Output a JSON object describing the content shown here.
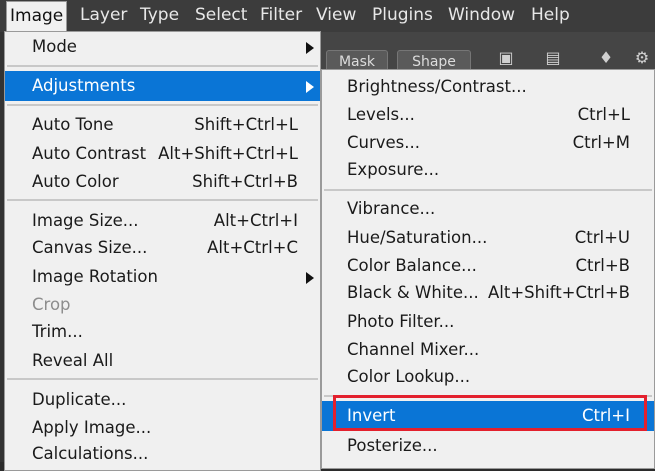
{
  "menubar": {
    "items": [
      "Image",
      "Layer",
      "Type",
      "Select",
      "Filter",
      "View",
      "Plugins",
      "Window",
      "Help"
    ]
  },
  "toolbar_behind": {
    "mask_label": "Mask",
    "shape_label": "Shape"
  },
  "image_menu": {
    "items": [
      {
        "label": "Mode",
        "shortcut": "",
        "submenu": true
      },
      {
        "label": "Adjustments",
        "shortcut": "",
        "submenu": true,
        "highlighted": true
      },
      {
        "label": "Auto Tone",
        "shortcut": "Shift+Ctrl+L"
      },
      {
        "label": "Auto Contrast",
        "shortcut": "Alt+Shift+Ctrl+L"
      },
      {
        "label": "Auto Color",
        "shortcut": "Shift+Ctrl+B"
      },
      {
        "label": "Image Size...",
        "shortcut": "Alt+Ctrl+I"
      },
      {
        "label": "Canvas Size...",
        "shortcut": "Alt+Ctrl+C"
      },
      {
        "label": "Image Rotation",
        "shortcut": "",
        "submenu": true
      },
      {
        "label": "Crop",
        "shortcut": "",
        "disabled": true
      },
      {
        "label": "Trim...",
        "shortcut": ""
      },
      {
        "label": "Reveal All",
        "shortcut": ""
      },
      {
        "label": "Duplicate...",
        "shortcut": ""
      },
      {
        "label": "Apply Image...",
        "shortcut": ""
      },
      {
        "label": "Calculations...",
        "shortcut": ""
      }
    ]
  },
  "adjustments_menu": {
    "items": [
      {
        "label": "Brightness/Contrast...",
        "shortcut": ""
      },
      {
        "label": "Levels...",
        "shortcut": "Ctrl+L"
      },
      {
        "label": "Curves...",
        "shortcut": "Ctrl+M"
      },
      {
        "label": "Exposure...",
        "shortcut": ""
      },
      {
        "label": "Vibrance...",
        "shortcut": ""
      },
      {
        "label": "Hue/Saturation...",
        "shortcut": "Ctrl+U"
      },
      {
        "label": "Color Balance...",
        "shortcut": "Ctrl+B"
      },
      {
        "label": "Black & White...",
        "shortcut": "Alt+Shift+Ctrl+B"
      },
      {
        "label": "Photo Filter...",
        "shortcut": ""
      },
      {
        "label": "Channel Mixer...",
        "shortcut": ""
      },
      {
        "label": "Color Lookup...",
        "shortcut": ""
      },
      {
        "label": "Invert",
        "shortcut": "Ctrl+I",
        "highlighted": true
      },
      {
        "label": "Posterize...",
        "shortcut": ""
      }
    ]
  },
  "colors": {
    "highlight": "#0a75d6",
    "annotation": "#e3202d"
  }
}
